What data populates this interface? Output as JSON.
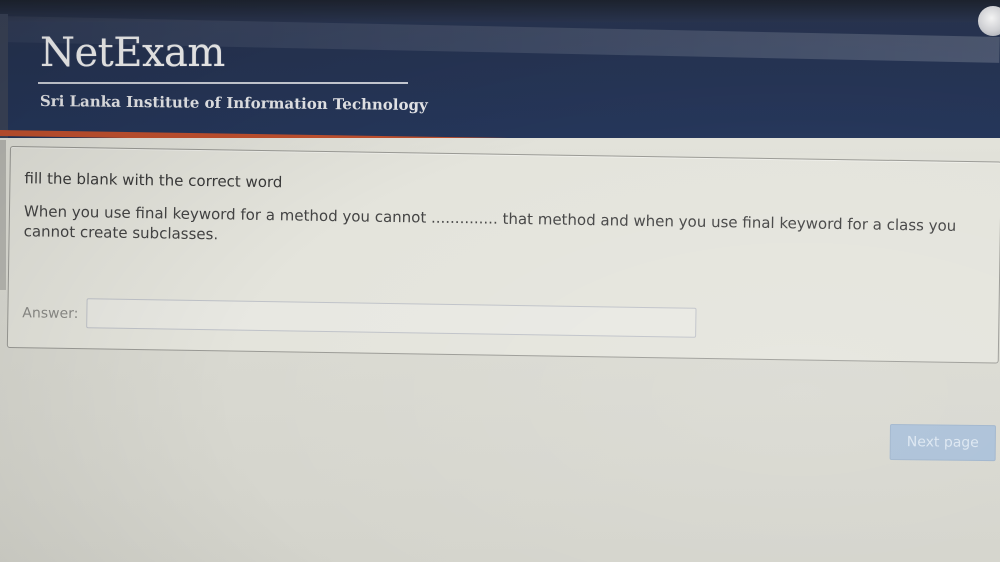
{
  "header": {
    "logo_text": "NetExam",
    "institute": "Sri Lanka Institute of Information Technology"
  },
  "question": {
    "instruction": "fill the blank with the correct word",
    "text": "When you use final keyword for a method you cannot .............. that method and when you use final keyword for a class you cannot create subclasses."
  },
  "answer": {
    "label": "Answer:",
    "value": "",
    "placeholder": ""
  },
  "navigation": {
    "next_label": "Next page"
  },
  "colors": {
    "header_bg": "#263453",
    "accent_border": "#c0502e",
    "button_bg": "#a9bfd7"
  },
  "icons": {
    "avatar": "user-avatar-icon"
  }
}
